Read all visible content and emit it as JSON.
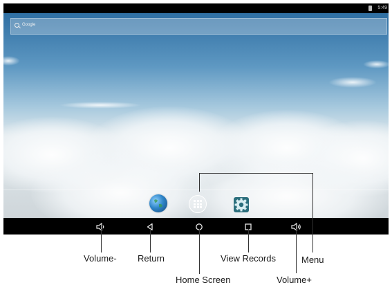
{
  "status_bar": {
    "time": "5:49"
  },
  "search": {
    "label": "Google"
  },
  "dock": {
    "apps": [
      {
        "name": "browser-icon"
      },
      {
        "name": "app-drawer-button"
      },
      {
        "name": "settings-icon"
      }
    ]
  },
  "nav_bar": {
    "buttons": [
      {
        "icon": "volume-down-icon"
      },
      {
        "icon": "back-icon"
      },
      {
        "icon": "home-icon"
      },
      {
        "icon": "recents-icon"
      },
      {
        "icon": "volume-up-icon"
      }
    ]
  },
  "callouts": {
    "volume_down": "Volume-",
    "return": "Return",
    "home_screen": "Home Screen",
    "view_records": "View Records",
    "volume_up": "Volume+",
    "menu": "Menu"
  },
  "colors": {
    "sky_top": "#2f6fa3",
    "nav_bar": "#000000",
    "label_text": "#1a1a1a"
  }
}
